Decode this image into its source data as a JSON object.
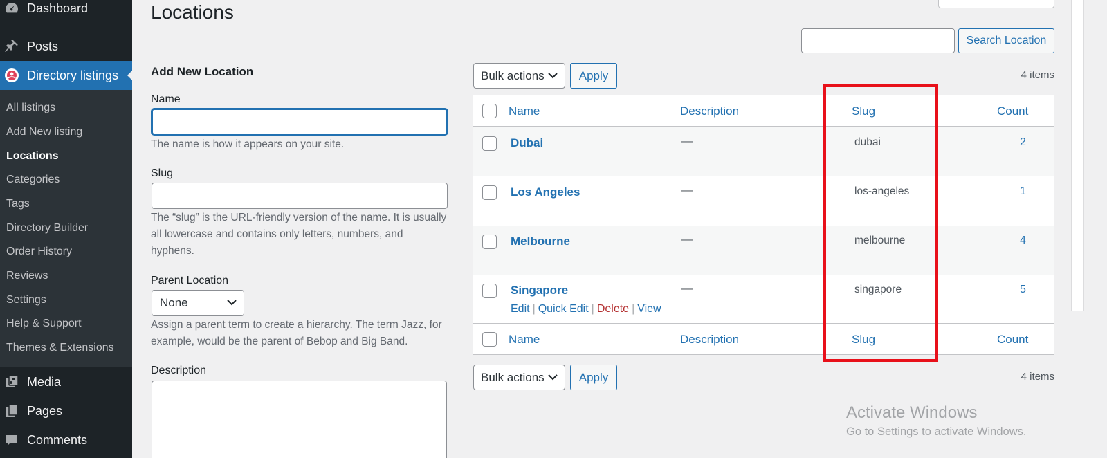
{
  "sidebar": {
    "top_items": [
      {
        "label": "Dashboard",
        "icon": "dashboard-icon"
      },
      {
        "label": "Posts",
        "icon": "pin-icon"
      },
      {
        "label": "Directory listings",
        "icon": "directory-icon"
      }
    ],
    "sub_items": [
      "All listings",
      "Add New listing",
      "Locations",
      "Categories",
      "Tags",
      "Directory Builder",
      "Order History",
      "Reviews",
      "Settings",
      "Help & Support",
      "Themes & Extensions"
    ],
    "bottom_items": [
      {
        "label": "Media",
        "icon": "media-icon"
      },
      {
        "label": "Pages",
        "icon": "pages-icon"
      },
      {
        "label": "Comments",
        "icon": "comments-icon"
      }
    ]
  },
  "page": {
    "title": "Locations"
  },
  "search": {
    "value": "",
    "button_label": "Search Location"
  },
  "form": {
    "heading": "Add New Location",
    "name_label": "Name",
    "name_value": "",
    "name_desc": "The name is how it appears on your site.",
    "slug_label": "Slug",
    "slug_value": "",
    "slug_desc": "The “slug” is the URL-friendly version of the name. It is usually all lowercase and contains only letters, numbers, and hyphens.",
    "parent_label": "Parent Location",
    "parent_value": "None",
    "parent_desc": "Assign a parent term to create a hierarchy. The term Jazz, for example, would be the parent of Bebop and Big Band.",
    "description_label": "Description"
  },
  "bulk": {
    "select_label": "Bulk actions",
    "apply_label": "Apply",
    "items_count": "4 items"
  },
  "table": {
    "columns": {
      "name": "Name",
      "description": "Description",
      "slug": "Slug",
      "count": "Count"
    },
    "rows": [
      {
        "name": "Dubai",
        "description": "—",
        "slug": "dubai",
        "count": "2"
      },
      {
        "name": "Los Angeles",
        "description": "—",
        "slug": "los-angeles",
        "count": "1"
      },
      {
        "name": "Melbourne",
        "description": "—",
        "slug": "melbourne",
        "count": "4"
      },
      {
        "name": "Singapore",
        "description": "—",
        "slug": "singapore",
        "count": "5"
      }
    ],
    "row_actions": {
      "edit": "Edit",
      "quick_edit": "Quick Edit",
      "delete": "Delete",
      "view": "View"
    }
  },
  "watermark": {
    "title": "Activate Windows",
    "subtitle": "Go to Settings to activate Windows."
  },
  "colors": {
    "sidebar_bg": "#1d2327",
    "accent": "#2271b1",
    "highlight": "#e8101a",
    "danger": "#b32d2e"
  }
}
